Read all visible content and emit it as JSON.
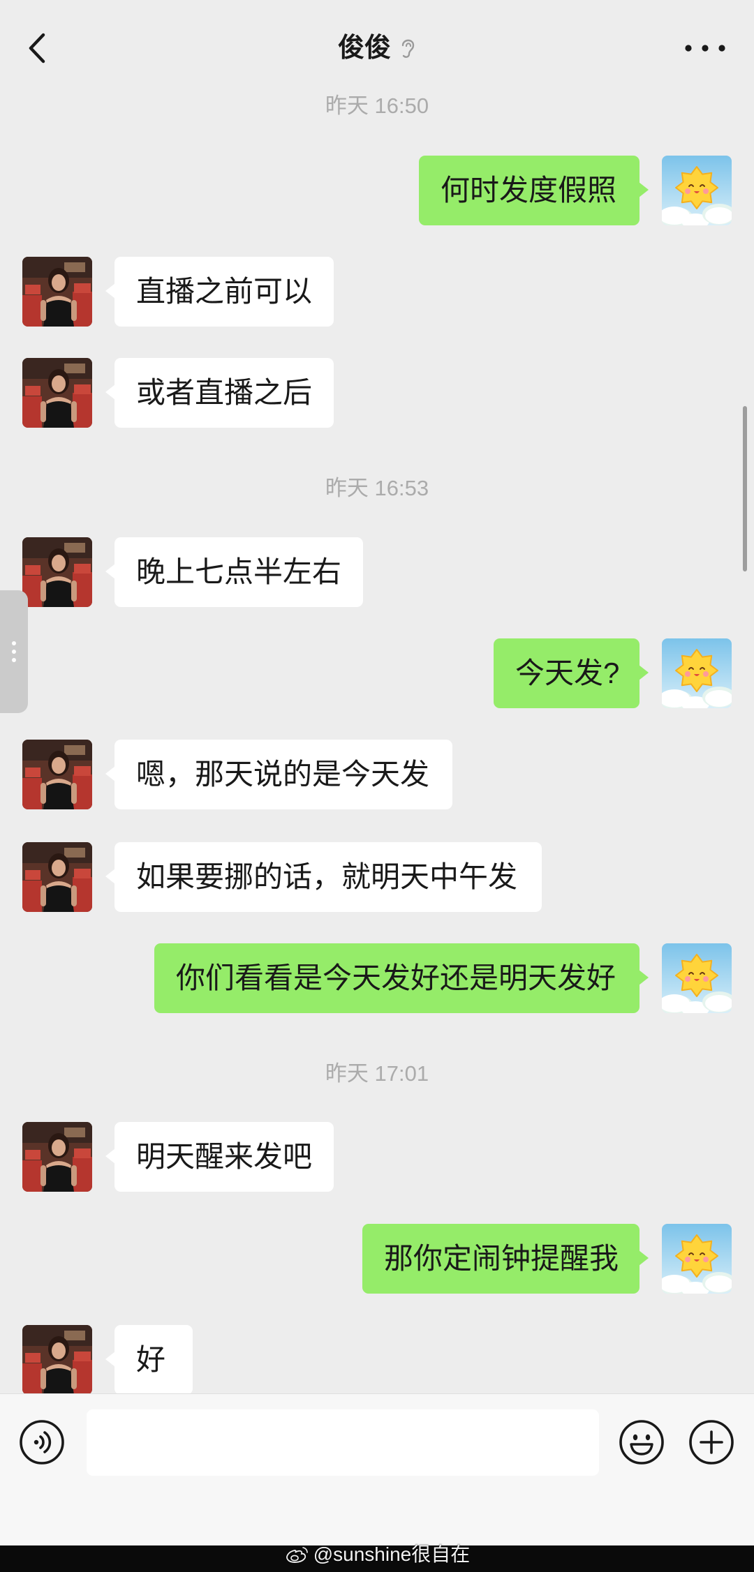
{
  "header": {
    "title": "俊俊"
  },
  "icons": {
    "back": "chevron-left-icon",
    "ear": "ear-icon",
    "more": "more-icon",
    "voice": "voice-icon",
    "emoji": "emoji-icon",
    "plus": "plus-icon",
    "watermark": "weibo-icon"
  },
  "colors": {
    "background": "#ededed",
    "sent_bubble": "#95ec69",
    "received_bubble": "#ffffff",
    "text": "#191919",
    "timestamp": "#ababab",
    "input_bar": "#f7f7f7"
  },
  "messages": [
    {
      "timestamp": "昨天 16:50"
    },
    {
      "outgoing": true,
      "text": "何时发度假照"
    },
    {
      "outgoing": false,
      "text": "直播之前可以"
    },
    {
      "outgoing": false,
      "text": "或者直播之后"
    },
    {
      "timestamp": "昨天 16:53"
    },
    {
      "outgoing": false,
      "text": "晚上七点半左右"
    },
    {
      "outgoing": true,
      "text": "今天发?"
    },
    {
      "outgoing": false,
      "text": "嗯，那天说的是今天发"
    },
    {
      "outgoing": false,
      "text": "如果要挪的话，就明天中午发"
    },
    {
      "outgoing": true,
      "text": "你们看看是今天发好还是明天发好"
    },
    {
      "timestamp": "昨天 17:01"
    },
    {
      "outgoing": false,
      "text": "明天醒来发吧"
    },
    {
      "outgoing": true,
      "text": "那你定闹钟提醒我"
    },
    {
      "outgoing": false,
      "text": "好"
    }
  ],
  "input_bar": {
    "value": ""
  },
  "watermark": {
    "text": "@sunshine很自在"
  }
}
